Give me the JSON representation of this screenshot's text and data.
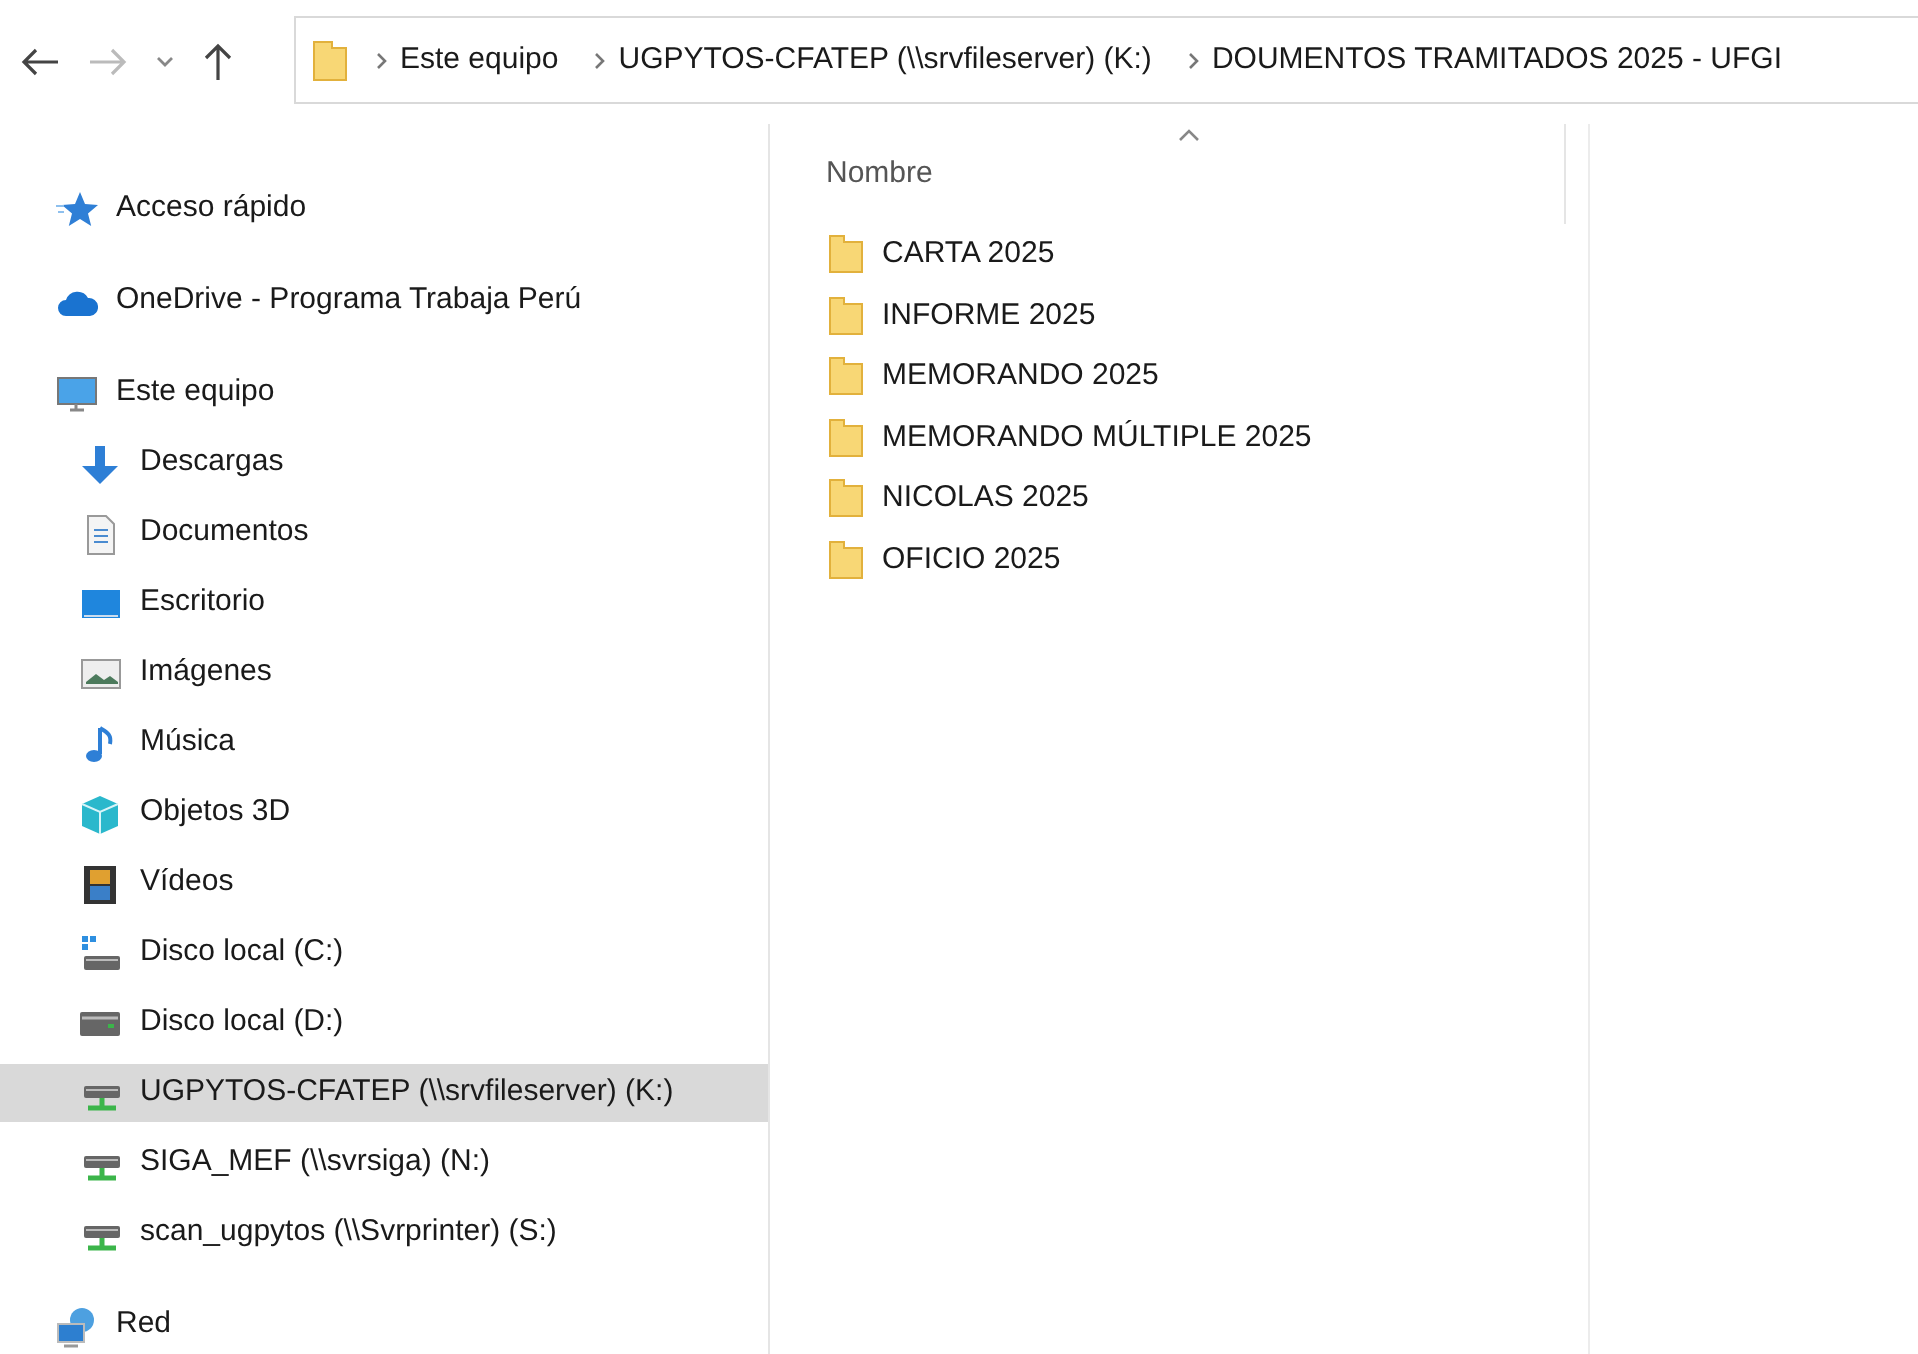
{
  "breadcrumb": [
    {
      "label": "Este equipo"
    },
    {
      "label": "UGPYTOS-CFATEP (\\\\srvfileserver) (K:)"
    },
    {
      "label": "DOUMENTOS TRAMITADOS 2025 - UFGI"
    }
  ],
  "sidebar": {
    "items": [
      {
        "label": "Acceso rápido",
        "kind": "star",
        "selected": false
      },
      {
        "label": "OneDrive - Programa Trabaja Perú",
        "kind": "cloud",
        "selected": false
      },
      {
        "label": "Este equipo",
        "kind": "computer",
        "selected": false,
        "children": [
          {
            "label": "Descargas",
            "kind": "download",
            "selected": false
          },
          {
            "label": "Documentos",
            "kind": "document",
            "selected": false
          },
          {
            "label": "Escritorio",
            "kind": "desktop",
            "selected": false
          },
          {
            "label": "Imágenes",
            "kind": "image",
            "selected": false
          },
          {
            "label": "Música",
            "kind": "music",
            "selected": false
          },
          {
            "label": "Objetos 3D",
            "kind": "cube",
            "selected": false
          },
          {
            "label": "Vídeos",
            "kind": "film",
            "selected": false
          },
          {
            "label": "Disco local (C:)",
            "kind": "system-drive",
            "selected": false
          },
          {
            "label": "Disco local (D:)",
            "kind": "drive",
            "selected": false
          },
          {
            "label": "UGPYTOS-CFATEP (\\\\srvfileserver) (K:)",
            "kind": "network-drive",
            "selected": true
          },
          {
            "label": "SIGA_MEF (\\\\svrsiga) (N:)",
            "kind": "network-drive",
            "selected": false
          },
          {
            "label": "scan_ugpytos (\\\\Svrprinter) (S:)",
            "kind": "network-drive",
            "selected": false
          }
        ]
      },
      {
        "label": "Red",
        "kind": "network",
        "selected": false
      }
    ]
  },
  "file_list": {
    "columns": [
      {
        "label": "Nombre"
      }
    ],
    "rows": [
      {
        "name": "CARTA 2025"
      },
      {
        "name": "INFORME 2025"
      },
      {
        "name": "MEMORANDO 2025"
      },
      {
        "name": "MEMORANDO MÚLTIPLE 2025"
      },
      {
        "name": "NICOLAS 2025"
      },
      {
        "name": "OFICIO 2025"
      }
    ]
  }
}
